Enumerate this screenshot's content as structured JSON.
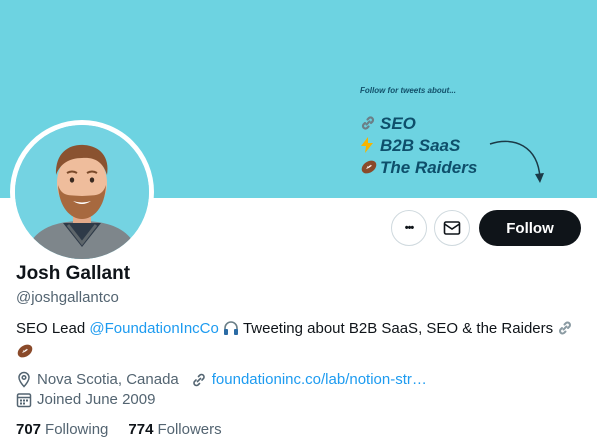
{
  "banner": {
    "tagline": "Follow for tweets about...",
    "topics": [
      "SEO",
      "B2B SaaS",
      "The Raiders"
    ]
  },
  "actions": {
    "more_label": "•••",
    "follow_label": "Follow"
  },
  "profile": {
    "name": "Josh Gallant",
    "handle": "@joshgallantco",
    "bio": {
      "prefix": "SEO Lead ",
      "mention": "@FoundationIncCo",
      "suffix": " Tweeting about B2B SaaS, SEO & the Raiders "
    },
    "location": "Nova Scotia, Canada",
    "website": "foundationinc.co/lab/notion-str…",
    "joined": "Joined June 2009"
  },
  "stats": {
    "following_count": "707",
    "following_label": "Following",
    "followers_count": "774",
    "followers_label": "Followers"
  },
  "colors": {
    "banner": "#6dd3e1",
    "accent": "#1d9bf0",
    "follow_button": "#0f1419"
  },
  "icons": [
    "link-icon",
    "lightning-icon",
    "football-icon",
    "more-icon",
    "mail-icon",
    "location-pin-icon",
    "calendar-icon",
    "headphones-icon"
  ]
}
